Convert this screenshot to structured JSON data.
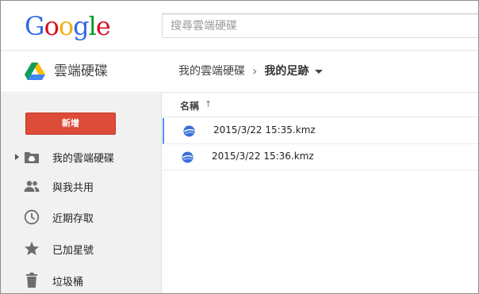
{
  "google_logo": {
    "letters": [
      {
        "char": "G",
        "color": "#3369e8"
      },
      {
        "char": "o",
        "color": "#d50f25"
      },
      {
        "char": "o",
        "color": "#eeb211"
      },
      {
        "char": "g",
        "color": "#3369e8"
      },
      {
        "char": "l",
        "color": "#009925"
      },
      {
        "char": "e",
        "color": "#d50f25"
      }
    ]
  },
  "search": {
    "placeholder": "搜尋雲端硬碟",
    "value": ""
  },
  "header": {
    "app_title": "雲端硬碟",
    "breadcrumb": {
      "parent": "我的雲端硬碟",
      "separator": "›",
      "current": "我的足跡"
    }
  },
  "sidebar": {
    "new_button_label": "新增",
    "items": [
      {
        "label": "我的雲端硬碟",
        "icon": "drive-folder-icon",
        "has_expander": true
      },
      {
        "label": "與我共用",
        "icon": "people-icon"
      },
      {
        "label": "近期存取",
        "icon": "clock-icon"
      },
      {
        "label": "已加星號",
        "icon": "star-icon"
      },
      {
        "label": "垃圾桶",
        "icon": "trash-icon"
      }
    ]
  },
  "file_list": {
    "column_name": "名稱",
    "sort_indicator": "↑",
    "files": [
      {
        "name": "2015/3/22 15:35.kmz",
        "icon": "google-earth-icon",
        "selected": true
      },
      {
        "name": "2015/3/22 15:36.kmz",
        "icon": "google-earth-icon",
        "selected": false
      }
    ]
  },
  "colors": {
    "new_button": "#dd4b39",
    "sidebar_bg": "#f1f1f1",
    "selection_accent": "#4d90fe"
  }
}
